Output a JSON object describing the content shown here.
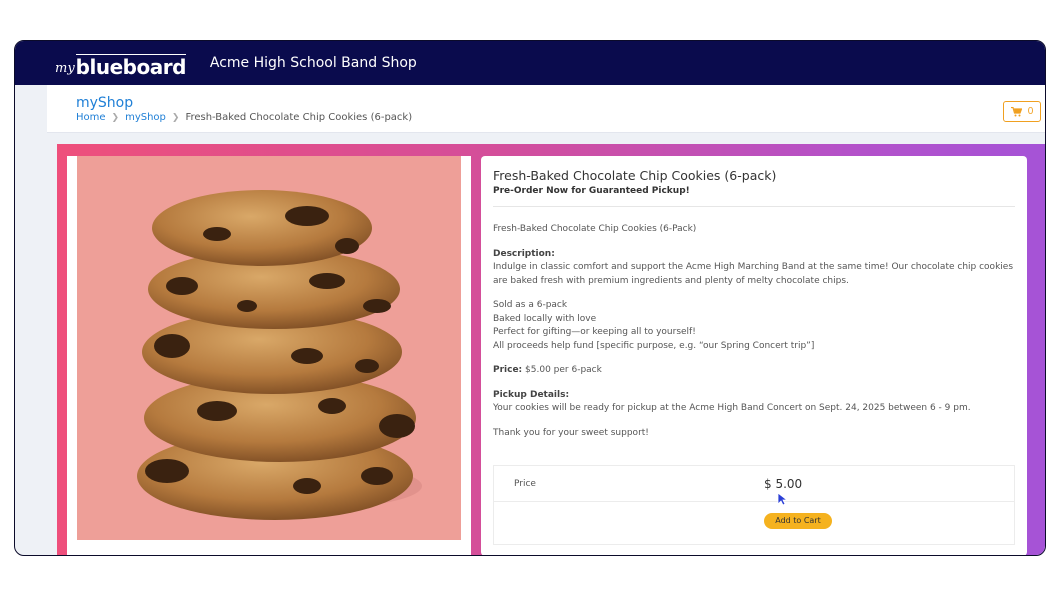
{
  "header": {
    "logo_my": "my",
    "logo_brand": "blueboard",
    "shop_name": "Acme High School Band Shop"
  },
  "subheader": {
    "title": "myShop",
    "breadcrumb": {
      "home": "Home",
      "shop": "myShop",
      "current": "Fresh-Baked Chocolate Chip Cookies (6-pack)"
    },
    "cart_count": "0"
  },
  "product": {
    "title": "Fresh-Baked Chocolate Chip Cookies (6-pack)",
    "subtitle": "Pre-Order Now for Guaranteed Pickup!",
    "name_line": "Fresh-Baked Chocolate Chip Cookies (6-Pack)",
    "description_label": "Description:",
    "description": "Indulge in classic comfort and support the Acme High Marching Band at the same time! Our chocolate chip cookies are baked fresh with premium ingredients and plenty of melty chocolate chips.",
    "bullets": [
      "Sold as a 6-pack",
      "Baked locally with love",
      "Perfect for gifting—or keeping all to yourself!",
      "All proceeds help fund [specific purpose, e.g. “our Spring Concert trip”]"
    ],
    "price_label": "Price:",
    "price_text": "$5.00 per 6-pack",
    "pickup_label": "Pickup Details:",
    "pickup_text": "Your cookies will be ready for pickup at the Acme High Band Concert on Sept. 24, 2025 between 6 - 9 pm.",
    "thanks": "Thank you for your sweet support!"
  },
  "purchase": {
    "price_label": "Price",
    "price_value": "$ 5.00",
    "add_to_cart": "Add to Cart"
  },
  "colors": {
    "topbar": "#0a0b4d",
    "link": "#1f7fd6",
    "accent": "#f5b21f"
  }
}
